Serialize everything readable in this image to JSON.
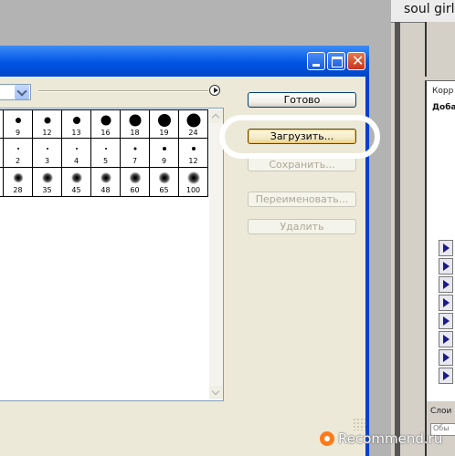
{
  "background_app": {
    "top_label": "soul girl",
    "panel_labels": [
      "Корр",
      "Доба"
    ],
    "bottom_label": "Слои",
    "bottom_field_placeholder": "Обы"
  },
  "dialog": {
    "select_value": "",
    "presets": [
      {
        "size": "9",
        "dot": 6,
        "soft": false
      },
      {
        "size": "12",
        "dot": 7,
        "soft": false
      },
      {
        "size": "13",
        "dot": 8,
        "soft": false
      },
      {
        "size": "16",
        "dot": 11,
        "soft": false
      },
      {
        "size": "18",
        "dot": 13,
        "soft": false
      },
      {
        "size": "19",
        "dot": 14,
        "soft": false
      },
      {
        "size": "24",
        "dot": 15,
        "soft": false
      },
      {
        "size": "2",
        "dot": 2,
        "soft": false
      },
      {
        "size": "3",
        "dot": 2,
        "soft": false
      },
      {
        "size": "4",
        "dot": 2,
        "soft": false
      },
      {
        "size": "5",
        "dot": 2,
        "soft": false
      },
      {
        "size": "7",
        "dot": 3,
        "soft": false
      },
      {
        "size": "9",
        "dot": 4,
        "soft": false
      },
      {
        "size": "12",
        "dot": 4,
        "soft": false
      },
      {
        "size": "28",
        "dot": 9,
        "soft": true
      },
      {
        "size": "35",
        "dot": 10,
        "soft": true
      },
      {
        "size": "45",
        "dot": 10,
        "soft": true
      },
      {
        "size": "48",
        "dot": 10,
        "soft": true
      },
      {
        "size": "60",
        "dot": 11,
        "soft": true
      },
      {
        "size": "65",
        "dot": 11,
        "soft": true
      },
      {
        "size": "100",
        "dot": 12,
        "soft": true
      }
    ],
    "buttons": {
      "done": "Готово",
      "load": "Загрузить...",
      "save": "Сохранить...",
      "rename": "Переименовать...",
      "delete": "Удалить"
    },
    "close_glyph": "✕"
  },
  "watermark": {
    "text": "Recommend.ru"
  }
}
